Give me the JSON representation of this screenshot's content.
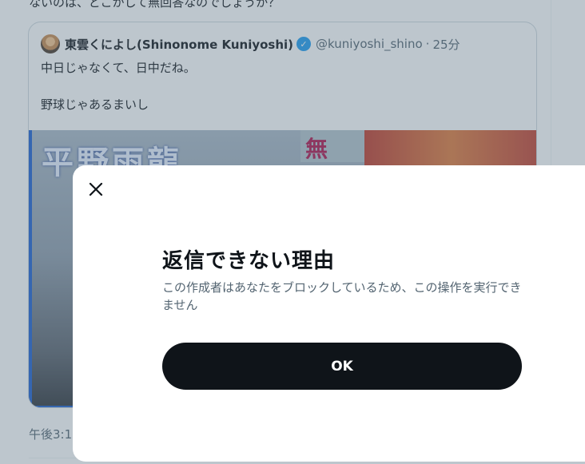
{
  "feed": {
    "top_clipped_text": "ないのは、どこかして無回答なのでしょうか？",
    "quote": {
      "display_name": "東雲くによし(Shinonome Kuniyoshi)",
      "verified_icon": "verified-badge-icon",
      "handle": "@kuniyoshi_shino",
      "dot": "·",
      "time": "25分",
      "text": "中日じゃなくて、日中だね。\n\n野球じゃあるまいし",
      "media_caption": "平野雨龍",
      "media_sign": "無"
    },
    "post_time": "午後3:1"
  },
  "modal": {
    "close_icon": "close-icon",
    "title": "返信できない理由",
    "body": "この作成者はあなたをブロックしているため、この操作を実行できません",
    "ok_label": "OK"
  },
  "colors": {
    "overlay": "#5b7083",
    "button_bg": "#0f1419",
    "secondary_text": "#536471",
    "verified": "#1d9bf0"
  }
}
